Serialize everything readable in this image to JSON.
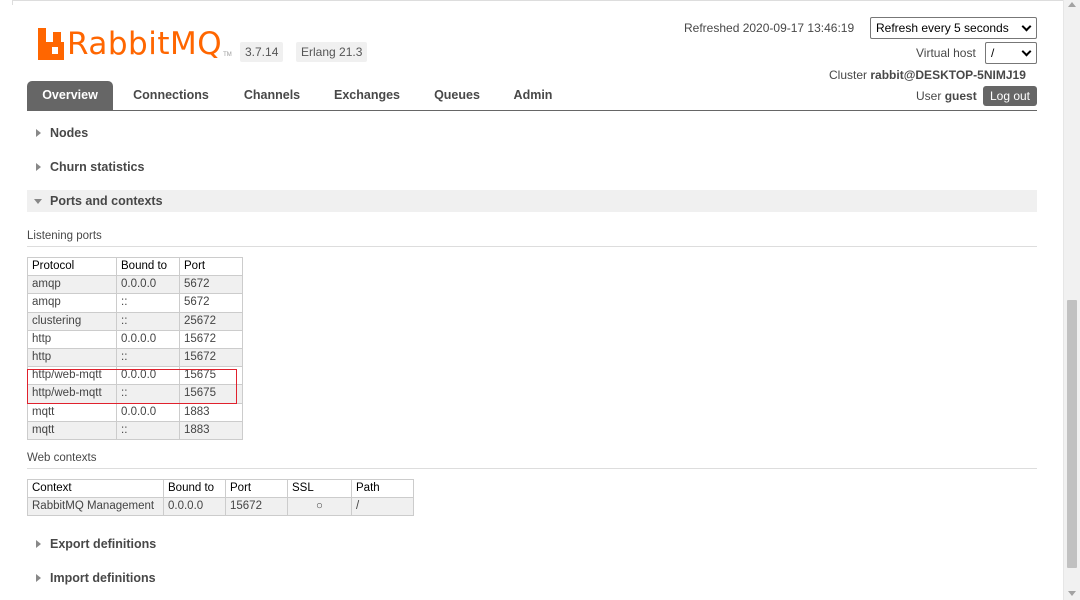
{
  "header": {
    "logo_text": "RabbitMQ",
    "logo_tm": "TM",
    "version": "3.7.14",
    "erlang": "Erlang 21.3",
    "refreshed": "Refreshed 2020-09-17 13:46:19",
    "refresh_select": "Refresh every 5 seconds",
    "vhost_label": "Virtual host",
    "vhost_select": "/",
    "cluster_label": "Cluster",
    "cluster_name": "rabbit@DESKTOP-5NIMJ19",
    "user_label": "User",
    "user_name": "guest",
    "logout_label": "Log out"
  },
  "tabs": [
    {
      "label": "Overview"
    },
    {
      "label": "Connections"
    },
    {
      "label": "Channels"
    },
    {
      "label": "Exchanges"
    },
    {
      "label": "Queues"
    },
    {
      "label": "Admin"
    }
  ],
  "sections": {
    "nodes": "Nodes",
    "churn": "Churn statistics",
    "ports": "Ports and contexts",
    "export": "Export definitions",
    "import": "Import definitions"
  },
  "listening_ports": {
    "heading": "Listening ports",
    "columns": [
      "Protocol",
      "Bound to",
      "Port"
    ],
    "rows": [
      [
        "amqp",
        "0.0.0.0",
        "5672"
      ],
      [
        "amqp",
        "::",
        "5672"
      ],
      [
        "clustering",
        "::",
        "25672"
      ],
      [
        "http",
        "0.0.0.0",
        "15672"
      ],
      [
        "http",
        "::",
        "15672"
      ],
      [
        "http/web-mqtt",
        "0.0.0.0",
        "15675"
      ],
      [
        "http/web-mqtt",
        "::",
        "15675"
      ],
      [
        "mqtt",
        "0.0.0.0",
        "1883"
      ],
      [
        "mqtt",
        "::",
        "1883"
      ]
    ]
  },
  "web_contexts": {
    "heading": "Web contexts",
    "columns": [
      "Context",
      "Bound to",
      "Port",
      "SSL",
      "Path"
    ],
    "rows": [
      [
        "RabbitMQ Management",
        "0.0.0.0",
        "15672",
        "○",
        "/"
      ]
    ]
  },
  "colors": {
    "brand": "#ff6600",
    "tab_active": "#666666",
    "highlight": "#e0212d"
  }
}
